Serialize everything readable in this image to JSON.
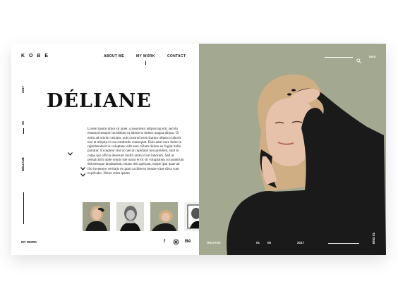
{
  "brand": {
    "logo": "K O B E"
  },
  "nav": {
    "about": "ABOUT ME",
    "work": "MY WORK",
    "contact": "CONTACT"
  },
  "sidebar": {
    "year": "2017",
    "number": "05",
    "name": "DÉLIANE"
  },
  "hero": {
    "title": "DÉLIANE",
    "description": "Lorem ipsum dolor sit amet, consectetur adipiscing elit, sed do eiusmod tempor incididunt ut labore et dolore magna aliqua. Ut enim ad minim veniam, quis nostrud exercitation ullamco laboris nisi ut aliquip ex ea commodo consequat. Duis aute irure dolor in reprehenderit in voluptate velit esse cillum dolore eu fugiat nulla pariatur. Excepteur sint occaecat cupidatat non proident, sunt in culpa qui officia deserunt mollit anim id est laborum. Sed ut perspiciatis unde omnis iste natus error sit voluptatem accusantium doloremque laudantium, totam rem aperiam, eaque ipsa quae ab illo inventore veritatis et quasi architecto beatae vitae dicta sunt explicabo. Nemo enim ipsam"
  },
  "footer": {
    "my_work": "MY WORK"
  },
  "social": {
    "facebook": "f",
    "behance": "Bē"
  },
  "right_panel": {
    "language": "ENG",
    "caption_name": "DÉLIANE",
    "caption_num1": "01",
    "caption_num2": "05",
    "caption_year": "2017",
    "side_tag": "ENG 01"
  },
  "colors": {
    "photo_bg": "#a3a890",
    "sweater": "#1a1a1a",
    "skin": "#e6c2aa",
    "hair": "#cfae84"
  },
  "icons": [
    "search-icon",
    "facebook-icon",
    "instagram-icon",
    "behance-icon",
    "chevron-down-icon"
  ]
}
